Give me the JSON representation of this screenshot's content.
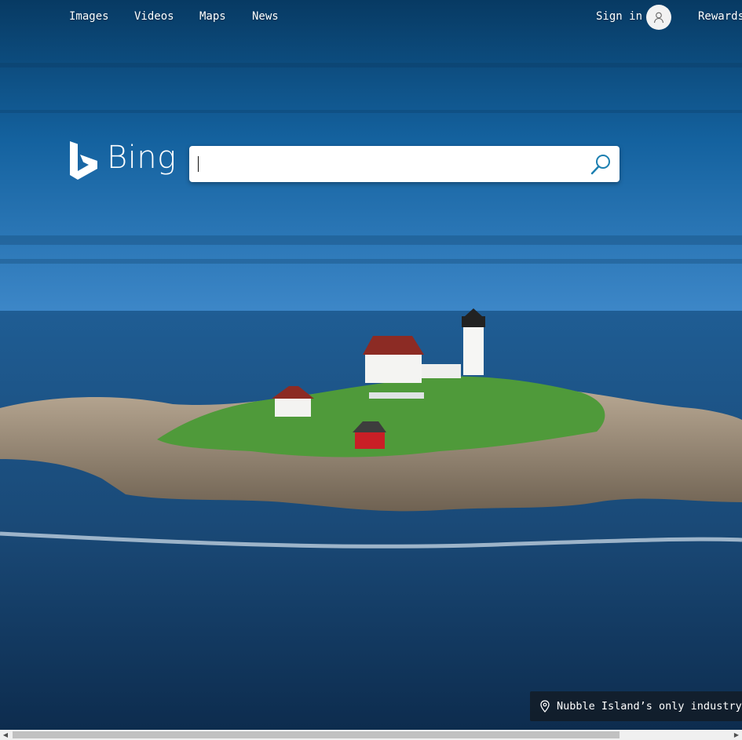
{
  "nav": {
    "images": "Images",
    "videos": "Videos",
    "maps": "Maps",
    "news": "News"
  },
  "account": {
    "sign_in": "Sign in",
    "rewards": "Rewards"
  },
  "logo": {
    "text": "Bing"
  },
  "search": {
    "value": "",
    "placeholder": ""
  },
  "caption": {
    "text": "Nubble Island’s only industry"
  },
  "colors": {
    "sky": "#1e6aa8",
    "sea": "#1c4d7c",
    "accent": "#1c8ec7"
  }
}
